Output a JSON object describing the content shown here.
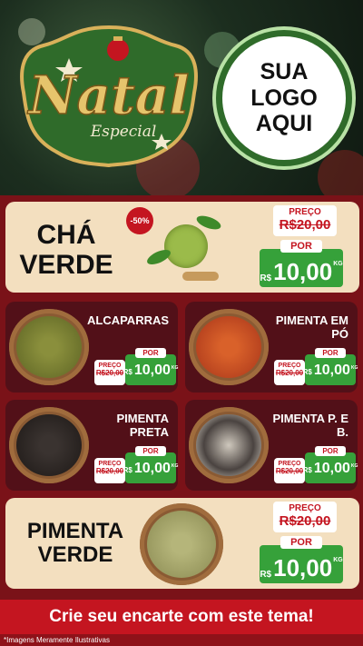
{
  "header": {
    "badge_title": "Natal",
    "badge_subtitle": "Especial",
    "logo_lines": [
      "SUA",
      "LOGO",
      "AQUI"
    ]
  },
  "products": {
    "cha_verde": {
      "name_line1": "CHÁ",
      "name_line2": "VERDE",
      "discount": "-50%",
      "price_label": "PREÇO",
      "old_price": "R$20,00",
      "new_label": "POR",
      "currency": "R$",
      "new_price": "10,00",
      "unit": "KG"
    },
    "alcaparras": {
      "name": "ALCAPARRAS",
      "price_label": "PREÇO",
      "old_price": "R$20,00",
      "new_label": "POR",
      "currency": "R$",
      "new_price": "10,00",
      "unit": "KG"
    },
    "pimenta_po": {
      "name": "PIMENTA EM PÓ",
      "price_label": "PREÇO",
      "old_price": "R$20,00",
      "new_label": "POR",
      "currency": "R$",
      "new_price": "10,00",
      "unit": "KG"
    },
    "pimenta_preta": {
      "name": "PIMENTA PRETA",
      "price_label": "PREÇO",
      "old_price": "R$20,00",
      "new_label": "POR",
      "currency": "R$",
      "new_price": "10,00",
      "unit": "KG"
    },
    "pimenta_pb": {
      "name": "PIMENTA P. E B.",
      "price_label": "PREÇO",
      "old_price": "R$20,00",
      "new_label": "POR",
      "currency": "R$",
      "new_price": "10,00",
      "unit": "KG"
    },
    "pimenta_verde": {
      "name_line1": "PIMENTA",
      "name_line2": "VERDE",
      "price_label": "PREÇO",
      "old_price": "R$20,00",
      "new_label": "POR",
      "currency": "R$",
      "new_price": "10,00",
      "unit": "KG"
    }
  },
  "footer": {
    "cta": "Crie seu encarte com este tema!",
    "disclaimer": "*Imagens Meramente Ilustrativas"
  },
  "colors": {
    "accent_red": "#c41520",
    "price_green": "#36a13a",
    "card_cream": "#f3dfbf",
    "card_dark": "#521018",
    "background": "#7a1218"
  }
}
